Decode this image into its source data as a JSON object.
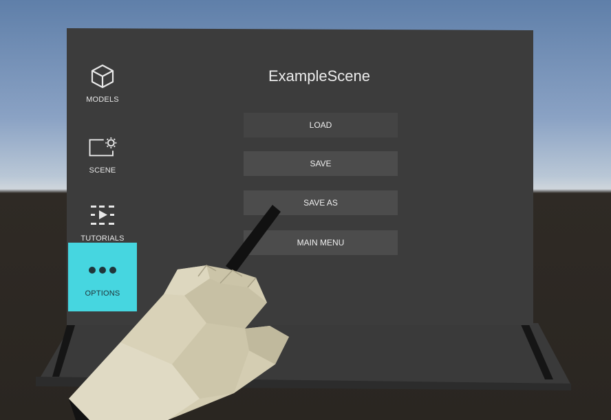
{
  "sidebar": {
    "items": [
      {
        "label": "MODELS",
        "icon": "cube-icon"
      },
      {
        "label": "SCENE",
        "icon": "scene-settings-icon"
      },
      {
        "label": "TUTORIALS",
        "icon": "tutorial-play-icon"
      },
      {
        "label": "OPTIONS",
        "icon": "more-dots-icon",
        "active": true
      }
    ]
  },
  "main": {
    "title": "ExampleScene",
    "buttons": [
      {
        "label": "LOAD"
      },
      {
        "label": "SAVE"
      },
      {
        "label": "SAVE AS"
      },
      {
        "label": "MAIN MENU"
      }
    ]
  },
  "colors": {
    "panel": "#3c3c3c",
    "button": "#4c4c4c",
    "accent": "#46d6e0",
    "hand": "#d4cdb2",
    "pointer": "#111111"
  },
  "scene_objects": {
    "hand": "vr-hand-icon",
    "pointer": "pointer-stick-icon"
  }
}
